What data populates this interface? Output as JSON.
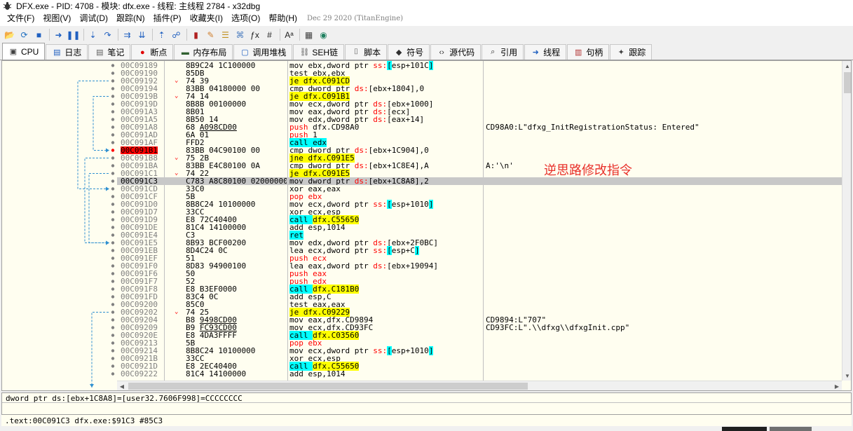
{
  "window": {
    "title": "DFX.exe - PID: 4708 - 模块: dfx.exe - 线程: 主线程 2784 - x32dbg"
  },
  "menu": {
    "items": [
      "文件(F)",
      "视图(V)",
      "调试(D)",
      "跟踪(N)",
      "插件(P)",
      "收藏夹(I)",
      "选项(O)",
      "帮助(H)"
    ],
    "build_info": "Dec 29 2020 (TitanEngine)"
  },
  "toolbar": {
    "icons": [
      "open-icon",
      "restart-icon",
      "stop-icon",
      "sep",
      "run-icon",
      "pause-icon",
      "sep",
      "step-into-icon",
      "step-over-icon",
      "sep",
      "trace-into-icon",
      "trace-over-icon",
      "sep",
      "execute-till-return-icon",
      "run-to-user-code-icon",
      "sep",
      "patch-icon",
      "comment-icon",
      "label-icon",
      "bookmark-icon",
      "function-icon",
      "argument-icon",
      "sep",
      "font-icon",
      "sep",
      "memory-icon",
      "web-icon"
    ]
  },
  "tabs": [
    {
      "label": "CPU",
      "icon": "cpu-icon",
      "active": true
    },
    {
      "label": "日志",
      "icon": "log-icon"
    },
    {
      "label": "笔记",
      "icon": "notes-icon"
    },
    {
      "label": "断点",
      "icon": "breakpoint-icon"
    },
    {
      "label": "内存布局",
      "icon": "memory-map-icon"
    },
    {
      "label": "调用堆栈",
      "icon": "call-stack-icon"
    },
    {
      "label": "SEH链",
      "icon": "seh-icon"
    },
    {
      "label": "脚本",
      "icon": "script-icon"
    },
    {
      "label": "符号",
      "icon": "symbol-icon"
    },
    {
      "label": "源代码",
      "icon": "source-icon"
    },
    {
      "label": "引用",
      "icon": "references-icon"
    },
    {
      "label": "线程",
      "icon": "threads-icon"
    },
    {
      "label": "句柄",
      "icon": "handles-icon"
    },
    {
      "label": "跟踪",
      "icon": "trace-icon"
    }
  ],
  "disasm": {
    "rows": [
      {
        "addr": "00C09189",
        "bytes": "8B9C24 1C100000",
        "arrow": "",
        "instr": [
          [
            "t",
            "mov ebx,dword ptr "
          ],
          [
            "s",
            "ss:"
          ],
          [
            "b",
            "["
          ],
          [
            "t",
            "esp+101C"
          ],
          [
            "b",
            "]"
          ]
        ],
        "comment": ""
      },
      {
        "addr": "00C09190",
        "bytes": "85DB",
        "arrow": "",
        "instr": [
          [
            "t",
            "test ebx,ebx"
          ]
        ],
        "comment": ""
      },
      {
        "addr": "00C09192",
        "bytes": "74 39",
        "arrow": "v",
        "instr": [
          [
            "y",
            "je dfx.C091CD"
          ]
        ],
        "comment": ""
      },
      {
        "addr": "00C09194",
        "bytes": "83BB 04180000 00",
        "arrow": "",
        "instr": [
          [
            "t",
            "cmp dword ptr "
          ],
          [
            "s",
            "ds:"
          ],
          [
            "t",
            "[ebx+1804],0"
          ]
        ],
        "comment": ""
      },
      {
        "addr": "00C0919B",
        "bytes": "74 14",
        "arrow": "v",
        "instr": [
          [
            "y",
            "je dfx.C091B1"
          ]
        ],
        "comment": ""
      },
      {
        "addr": "00C0919D",
        "bytes": "8B8B 00100000",
        "arrow": "",
        "instr": [
          [
            "t",
            "mov ecx,dword ptr "
          ],
          [
            "s",
            "ds:"
          ],
          [
            "t",
            "[ebx+1000]"
          ]
        ],
        "comment": ""
      },
      {
        "addr": "00C091A3",
        "bytes": "8B01",
        "arrow": "",
        "instr": [
          [
            "t",
            "mov eax,dword ptr "
          ],
          [
            "s",
            "ds:"
          ],
          [
            "t",
            "[ecx]"
          ]
        ],
        "comment": ""
      },
      {
        "addr": "00C091A5",
        "bytes": "8B50 14",
        "arrow": "",
        "instr": [
          [
            "t",
            "mov edx,dword ptr "
          ],
          [
            "s",
            "ds:"
          ],
          [
            "t",
            "[eax+14]"
          ]
        ],
        "comment": ""
      },
      {
        "addr": "00C091A8",
        "bytes": "68 A098CD00",
        "ubytes": "A098CD00",
        "arrow": "",
        "instr": [
          [
            "s",
            "push "
          ],
          [
            "t",
            "dfx.CD98A0"
          ]
        ],
        "comment": "CD98A0:L\"dfxg_InitRegistrationStatus: Entered\""
      },
      {
        "addr": "00C091AD",
        "bytes": "6A 01",
        "arrow": "",
        "instr": [
          [
            "s",
            "push "
          ],
          [
            "t",
            "1"
          ]
        ],
        "comment": ""
      },
      {
        "addr": "00C091AF",
        "bytes": "FFD2",
        "arrow": "",
        "instr": [
          [
            "c",
            "call edx"
          ]
        ],
        "comment": ""
      },
      {
        "addr": "00C091B1",
        "bytes": "83BB 04C90100 00",
        "arrow": "",
        "bp": true,
        "instr": [
          [
            "t",
            "cmp dword ptr "
          ],
          [
            "s",
            "ds:"
          ],
          [
            "t",
            "[ebx+1C904],0"
          ]
        ],
        "comment": ""
      },
      {
        "addr": "00C091B8",
        "bytes": "75 2B",
        "arrow": "v",
        "instr": [
          [
            "y",
            "jne dfx.C091E5"
          ]
        ],
        "comment": ""
      },
      {
        "addr": "00C091BA",
        "bytes": "83BB E4C80100 0A",
        "arrow": "",
        "instr": [
          [
            "t",
            "cmp dword ptr "
          ],
          [
            "s",
            "ds:"
          ],
          [
            "t",
            "[ebx+1C8E4],A"
          ]
        ],
        "comment": "A:'\\n'"
      },
      {
        "addr": "00C091C1",
        "bytes": "74 22",
        "arrow": "v",
        "instr": [
          [
            "y",
            "je dfx.C091E5"
          ]
        ],
        "comment": ""
      },
      {
        "addr": "00C091C3",
        "bytes": "C783 A8C80100 02000000",
        "arrow": "",
        "cur": true,
        "instr": [
          [
            "t",
            "mov dword ptr "
          ],
          [
            "s",
            "ds:"
          ],
          [
            "t",
            "[ebx+1C8A8],2"
          ]
        ],
        "comment": ""
      },
      {
        "addr": "00C091CD",
        "bytes": "33C0",
        "arrow": "",
        "instr": [
          [
            "t",
            "xor eax,eax"
          ]
        ],
        "comment": ""
      },
      {
        "addr": "00C091CF",
        "bytes": "5B",
        "arrow": "",
        "instr": [
          [
            "s",
            "pop ebx"
          ]
        ],
        "comment": ""
      },
      {
        "addr": "00C091D0",
        "bytes": "8B8C24 10100000",
        "arrow": "",
        "instr": [
          [
            "t",
            "mov ecx,dword ptr "
          ],
          [
            "s",
            "ss:"
          ],
          [
            "b",
            "["
          ],
          [
            "t",
            "esp+1010"
          ],
          [
            "b",
            "]"
          ]
        ],
        "comment": ""
      },
      {
        "addr": "00C091D7",
        "bytes": "33CC",
        "arrow": "",
        "instr": [
          [
            "t",
            "xor ecx,esp"
          ]
        ],
        "comment": ""
      },
      {
        "addr": "00C091D9",
        "bytes": "E8 72C40400",
        "arrow": "",
        "instr": [
          [
            "c",
            "call "
          ],
          [
            "y",
            "dfx.C55650"
          ]
        ],
        "comment": ""
      },
      {
        "addr": "00C091DE",
        "bytes": "81C4 14100000",
        "arrow": "",
        "instr": [
          [
            "t",
            "add esp,1014"
          ]
        ],
        "comment": ""
      },
      {
        "addr": "00C091E4",
        "bytes": "C3",
        "arrow": "",
        "instr": [
          [
            "c",
            "ret"
          ]
        ],
        "comment": ""
      },
      {
        "addr": "00C091E5",
        "bytes": "8B93 BCF00200",
        "arrow": "",
        "instr": [
          [
            "t",
            "mov edx,dword ptr "
          ],
          [
            "s",
            "ds:"
          ],
          [
            "t",
            "[ebx+2F0BC]"
          ]
        ],
        "comment": ""
      },
      {
        "addr": "00C091EB",
        "bytes": "8D4C24 0C",
        "arrow": "",
        "instr": [
          [
            "t",
            "lea ecx,dword ptr "
          ],
          [
            "s",
            "ss:"
          ],
          [
            "b",
            "["
          ],
          [
            "t",
            "esp+C"
          ],
          [
            "b",
            "]"
          ]
        ],
        "comment": ""
      },
      {
        "addr": "00C091EF",
        "bytes": "51",
        "arrow": "",
        "instr": [
          [
            "s",
            "push ecx"
          ]
        ],
        "comment": ""
      },
      {
        "addr": "00C091F0",
        "bytes": "8D83 94900100",
        "arrow": "",
        "instr": [
          [
            "t",
            "lea eax,dword ptr "
          ],
          [
            "s",
            "ds:"
          ],
          [
            "t",
            "[ebx+19094]"
          ]
        ],
        "comment": ""
      },
      {
        "addr": "00C091F6",
        "bytes": "50",
        "arrow": "",
        "instr": [
          [
            "s",
            "push eax"
          ]
        ],
        "comment": ""
      },
      {
        "addr": "00C091F7",
        "bytes": "52",
        "arrow": "",
        "instr": [
          [
            "s",
            "push edx"
          ]
        ],
        "comment": ""
      },
      {
        "addr": "00C091F8",
        "bytes": "E8 B3EF0000",
        "arrow": "",
        "instr": [
          [
            "c",
            "call "
          ],
          [
            "y",
            "dfx.C181B0"
          ]
        ],
        "comment": ""
      },
      {
        "addr": "00C091FD",
        "bytes": "83C4 0C",
        "arrow": "",
        "instr": [
          [
            "t",
            "add esp,C"
          ]
        ],
        "comment": ""
      },
      {
        "addr": "00C09200",
        "bytes": "85C0",
        "arrow": "",
        "instr": [
          [
            "t",
            "test eax,eax"
          ]
        ],
        "comment": ""
      },
      {
        "addr": "00C09202",
        "bytes": "74 25",
        "arrow": "v",
        "instr": [
          [
            "y",
            "je dfx.C09229"
          ]
        ],
        "comment": ""
      },
      {
        "addr": "00C09204",
        "bytes": "B8 9498CD00",
        "ubytes": "9498CD00",
        "arrow": "",
        "instr": [
          [
            "t",
            "mov eax,dfx.CD9894"
          ]
        ],
        "comment": "CD9894:L\"707\""
      },
      {
        "addr": "00C09209",
        "bytes": "B9 FC93CD00",
        "ubytes": "FC93CD00",
        "arrow": "",
        "instr": [
          [
            "t",
            "mov ecx,dfx.CD93FC"
          ]
        ],
        "comment": "CD93FC:L\".\\\\dfxg\\\\dfxgInit.cpp\""
      },
      {
        "addr": "00C0920E",
        "bytes": "E8 4DA3FFFF",
        "arrow": "",
        "instr": [
          [
            "c",
            "call "
          ],
          [
            "y",
            "dfx.C03560"
          ]
        ],
        "comment": ""
      },
      {
        "addr": "00C09213",
        "bytes": "5B",
        "arrow": "",
        "instr": [
          [
            "s",
            "pop ebx"
          ]
        ],
        "comment": ""
      },
      {
        "addr": "00C09214",
        "bytes": "8B8C24 10100000",
        "arrow": "",
        "instr": [
          [
            "t",
            "mov ecx,dword ptr "
          ],
          [
            "s",
            "ss:"
          ],
          [
            "b",
            "["
          ],
          [
            "t",
            "esp+1010"
          ],
          [
            "b",
            "]"
          ]
        ],
        "comment": ""
      },
      {
        "addr": "00C0921B",
        "bytes": "33CC",
        "arrow": "",
        "instr": [
          [
            "t",
            "xor ecx,esp"
          ]
        ],
        "comment": ""
      },
      {
        "addr": "00C0921D",
        "bytes": "E8 2EC40400",
        "arrow": "",
        "instr": [
          [
            "c",
            "call "
          ],
          [
            "y",
            "dfx.C55650"
          ]
        ],
        "comment": ""
      },
      {
        "addr": "00C09222",
        "bytes": "81C4 14100000",
        "arrow": "",
        "instr": [
          [
            "t",
            "add esp,1014"
          ]
        ],
        "comment": ""
      }
    ]
  },
  "annotation": "逆思路修改指令",
  "info": {
    "line1": "dword ptr ds:[ebx+1C8A8]=[user32.7606F998]=CCCCCCCC",
    "line2": ""
  },
  "status": ".text:00C091C3 dfx.exe:$91C3 #85C3",
  "colors": {
    "pane_bg": "#fffef0",
    "jump_highlight": "#ffff00",
    "call_highlight": "#00ffff",
    "breakpoint": "#ff0000",
    "segment": "#ff0000",
    "annotation": "#e8302a"
  }
}
